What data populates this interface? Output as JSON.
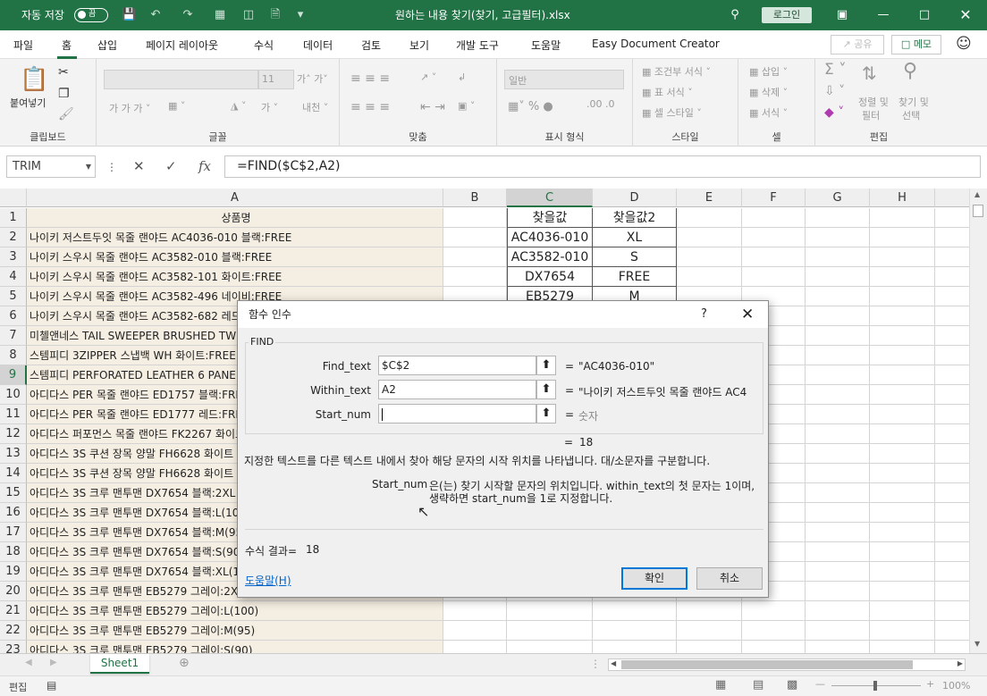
{
  "titlebar": {
    "autosave_label": "자동 저장",
    "autosave_state": "끔",
    "filename": "원하는 내용 찾기(찾기, 고급필터).xlsx",
    "login_label": "로그인"
  },
  "menubar": {
    "tabs": [
      "파일",
      "홈",
      "삽입",
      "페이지 레이아웃",
      "수식",
      "데이터",
      "검토",
      "보기",
      "개발 도구",
      "도움말",
      "Easy Document Creator"
    ],
    "active_tab": "홈",
    "share_label": "공유",
    "memo_label": "메모"
  },
  "ribbon": {
    "clipboard": {
      "paste_label": "붙여넣기",
      "group_label": "클립보드"
    },
    "font": {
      "font_size": "11",
      "group_label": "글꼴"
    },
    "alignment": {
      "group_label": "맞춤"
    },
    "number": {
      "format": "일반",
      "group_label": "표시 형식"
    },
    "styles": {
      "conditional": "조건부 서식",
      "table": "표 서식",
      "cell": "셀 스타일",
      "group_label": "스타일"
    },
    "cells": {
      "insert": "삽입",
      "delete": "삭제",
      "format": "서식",
      "group_label": "셀"
    },
    "editing": {
      "sort_filter": "정렬 및",
      "sort_filter2": "필터",
      "find_select": "찾기 및",
      "find_select2": "선택",
      "group_label": "편집"
    }
  },
  "formula_bar": {
    "name_box": "TRIM",
    "formula": "=FIND($C$2,A2)"
  },
  "grid": {
    "columns": [
      "A",
      "B",
      "C",
      "D",
      "E",
      "F",
      "G",
      "H"
    ],
    "selected_column": "C",
    "selected_row": "9",
    "rows": [
      {
        "n": "1",
        "a": "상품명",
        "c": "찾을값",
        "d": "찾을값2"
      },
      {
        "n": "2",
        "a": "나이키 저스트두잇 목줄 랜야드 AC4036-010 블랙:FREE",
        "c": "AC4036-010",
        "d": "XL"
      },
      {
        "n": "3",
        "a": "나이키 스우시 목줄 랜야드 AC3582-010 블랙:FREE",
        "c": "AC3582-010",
        "d": "S"
      },
      {
        "n": "4",
        "a": "나이키 스우시 목줄 랜야드 AC3582-101 화이트:FREE",
        "c": "DX7654",
        "d": "FREE"
      },
      {
        "n": "5",
        "a": "나이키 스우시 목줄 랜야드 AC3582-496 네이비:FREE",
        "c": "EB5279",
        "d": "M"
      },
      {
        "n": "6",
        "a": "나이키 스우시 목줄 랜야드 AC3582-682 레드:FREE",
        "c": "",
        "d": ""
      },
      {
        "n": "7",
        "a": "미첼앤네스 TAIL SWEEPER BRUSHED TWILL",
        "c": "",
        "d": ""
      },
      {
        "n": "8",
        "a": "스템피디 3ZIPPER 스냅백 WH 화이트:FREE",
        "c": "",
        "d": ""
      },
      {
        "n": "9",
        "a": "스템피디 PERFORATED LEATHER 6 PANEL BK",
        "c": "",
        "d": ""
      },
      {
        "n": "10",
        "a": "아디다스 PER 목줄 랜야드 ED1757 블랙:FREE",
        "c": "",
        "d": ""
      },
      {
        "n": "11",
        "a": "아디다스 PER 목줄 랜야드 ED1777 레드:FREE",
        "c": "",
        "d": ""
      },
      {
        "n": "12",
        "a": "아디다스 퍼포먼스 목줄 랜야드 FK2267 화이트",
        "c": "",
        "d": ""
      },
      {
        "n": "13",
        "a": "아디다스 3S 쿠션 장목 양말 FH6628 화이트",
        "c": "",
        "d": ""
      },
      {
        "n": "14",
        "a": "아디다스 3S 쿠션 장목 양말 FH6628 화이트",
        "c": "",
        "d": ""
      },
      {
        "n": "15",
        "a": "아디다스 3S 크루 맨투맨 DX7654 블랙:2XL",
        "c": "",
        "d": ""
      },
      {
        "n": "16",
        "a": "아디다스 3S 크루 맨투맨 DX7654 블랙:L(100)",
        "c": "",
        "d": ""
      },
      {
        "n": "17",
        "a": "아디다스 3S 크루 맨투맨 DX7654 블랙:M(95)",
        "c": "",
        "d": ""
      },
      {
        "n": "18",
        "a": "아디다스 3S 크루 맨투맨 DX7654 블랙:S(90)",
        "c": "",
        "d": ""
      },
      {
        "n": "19",
        "a": "아디다스 3S 크루 맨투맨 DX7654 블랙:XL(105)",
        "c": "",
        "d": ""
      },
      {
        "n": "20",
        "a": "아디다스 3S 크루 맨투맨 EB5279 그레이:2XL",
        "c": "",
        "d": ""
      },
      {
        "n": "21",
        "a": "아디다스 3S 크루 맨투맨 EB5279 그레이:L(100)",
        "c": "",
        "d": ""
      },
      {
        "n": "22",
        "a": "아디다스 3S 크루 맨투맨 EB5279 그레이:M(95)",
        "c": "",
        "d": ""
      },
      {
        "n": "23",
        "a": "아디다스 3S 크루 맨투맨 EB5279 그레이:S(90)",
        "c": "",
        "d": ""
      }
    ]
  },
  "sheets": {
    "active": "Sheet1"
  },
  "statusbar": {
    "mode": "편집",
    "zoom": "100%"
  },
  "dialog": {
    "title": "함수 인수",
    "help_glyph": "?",
    "function_name": "FIND",
    "args": [
      {
        "label": "Find_text",
        "value": "$C$2",
        "result": "\"AC4036-010\""
      },
      {
        "label": "Within_text",
        "value": "A2",
        "result": "\"나이키 저스트두잇 목줄 랜야드 AC4"
      },
      {
        "label": "Start_num",
        "value": "",
        "result": "숫자"
      }
    ],
    "function_result": "18",
    "description": "지정한 텍스트를 다른 텍스트 내에서 찾아 해당 문자의 시작 위치를 나타냅니다. 대/소문자를 구분합니다.",
    "arg_help_name": "Start_num",
    "arg_help_line1": "은(는) 찾기 시작할 문자의 위치입니다. within_text의 첫 문자는 1이며,",
    "arg_help_line2": "생략하면 start_num을 1로 지정합니다.",
    "formula_result_label": "수식 결과=",
    "formula_result": "18",
    "help_link": "도움말(H)",
    "ok_label": "확인",
    "cancel_label": "취소"
  }
}
